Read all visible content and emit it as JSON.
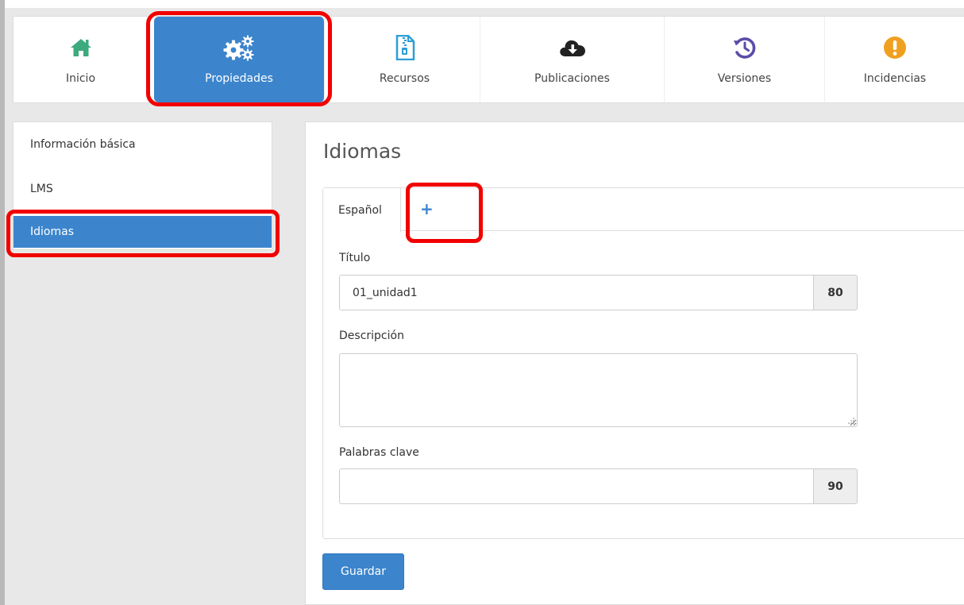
{
  "nav": {
    "items": [
      {
        "label": "Inicio",
        "icon": "home-icon"
      },
      {
        "label": "Propiedades",
        "icon": "gears-icon"
      },
      {
        "label": "Recursos",
        "icon": "zip-file-icon"
      },
      {
        "label": "Publicaciones",
        "icon": "cloud-download-icon"
      },
      {
        "label": "Versiones",
        "icon": "history-icon"
      },
      {
        "label": "Incidencias",
        "icon": "exclamation-circle-icon"
      }
    ],
    "active_index": 1
  },
  "sidebar": {
    "items": [
      {
        "label": "Información básica"
      },
      {
        "label": "LMS"
      },
      {
        "label": "Idiomas"
      }
    ],
    "active_index": 2
  },
  "main": {
    "title": "Idiomas",
    "tabs": [
      {
        "label": "Español"
      },
      {
        "label": "+"
      }
    ],
    "fields": {
      "titulo": {
        "label": "Título",
        "value": "01_unidad1",
        "max": "80"
      },
      "descripcion": {
        "label": "Descripción",
        "value": ""
      },
      "palabras": {
        "label": "Palabras clave",
        "value": "",
        "max": "90"
      }
    },
    "save_label": "Guardar"
  },
  "colors": {
    "primary": "#3c85cd",
    "home_icon": "#3daa7e",
    "history_icon": "#5b4ca8",
    "warning_icon": "#f0a020",
    "zip_icon": "#2a9fd6",
    "highlight": "#f20000"
  }
}
